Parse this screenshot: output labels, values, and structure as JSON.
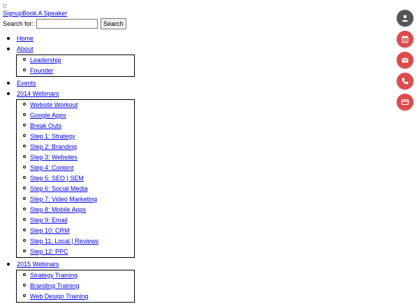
{
  "top_links": {
    "signup": "Signup",
    "book_speaker": "Book A Speaker"
  },
  "search": {
    "label": "Search for:",
    "value": "",
    "placeholder": "",
    "button_label": "Search"
  },
  "nav": {
    "home": "Home",
    "about": {
      "label": "About",
      "children": [
        "Leadership",
        "Founder"
      ]
    },
    "events": "Events",
    "webinars_2014": {
      "label": "2014 Webinars",
      "children": [
        "Website Workout",
        "Google Apps",
        "Break Outs",
        "Step 1: Strategy",
        "Step 2: Branding",
        "Step 3: Websites",
        "Step 4: Content",
        "Step 5: SEO | SEM",
        "Step 6: Social Media",
        "Step 7: Video Marketing",
        "Step 8: Mobile Apps",
        "Step 9: Email",
        "Step 10: CRM",
        "Step 11: Local | Reviews",
        "Step 12: PPC"
      ]
    },
    "webinars_2015": {
      "label": "2015 Webinars",
      "children": [
        "Strategy Training",
        "Branding Training",
        "Web Design Training"
      ]
    }
  },
  "floating_buttons": [
    {
      "icon": "user-icon",
      "color": "#555555"
    },
    {
      "icon": "calendar-icon",
      "color": "#dd4b4b"
    },
    {
      "icon": "mail-icon",
      "color": "#dd4b4b"
    },
    {
      "icon": "phone-icon",
      "color": "#dd4b4b"
    },
    {
      "icon": "credit-card-icon",
      "color": "#dd4b4b"
    }
  ]
}
